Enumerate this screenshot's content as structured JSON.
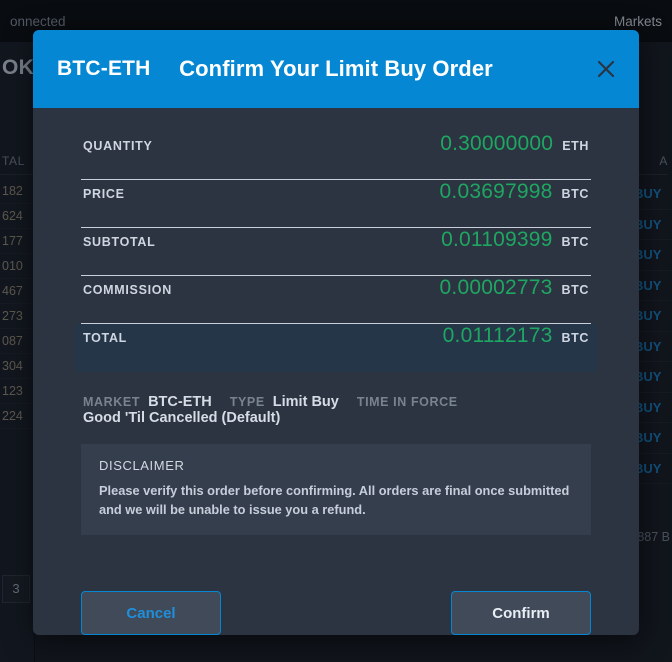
{
  "background": {
    "topbar": {
      "connection_status": "onnected",
      "nav_markets": "Markets"
    },
    "left_panel": {
      "title": "OK",
      "column_header": "TAL",
      "rows": [
        "182",
        "624",
        "177",
        "010",
        "467",
        "273",
        "087",
        "304",
        "123",
        "224"
      ],
      "page_chip": "3"
    },
    "right_panel": {
      "column_header": "A",
      "action_labels": [
        "BUY",
        "BUY",
        "BUY",
        "BUY",
        "BUY",
        "BUY",
        "BUY",
        "BUY",
        "BUY",
        "BUY"
      ],
      "footer_text": "7.887 B"
    }
  },
  "modal": {
    "market": "BTC-ETH",
    "title": "Confirm Your Limit Buy Order",
    "close_icon": "close-icon",
    "rows": [
      {
        "label": "QUANTITY",
        "value": "0.30000000",
        "unit": "ETH"
      },
      {
        "label": "PRICE",
        "value": "0.03697998",
        "unit": "BTC"
      },
      {
        "label": "SUBTOTAL",
        "value": "0.01109399",
        "unit": "BTC"
      },
      {
        "label": "COMMISSION",
        "value": "0.00002773",
        "unit": "BTC"
      },
      {
        "label": "TOTAL",
        "value": "0.01112173",
        "unit": "BTC"
      }
    ],
    "meta": [
      {
        "label": "MARKET",
        "value": "BTC-ETH"
      },
      {
        "label": "TYPE",
        "value": "Limit Buy"
      },
      {
        "label": "TIME IN FORCE",
        "value": "Good 'Til Cancelled (Default)"
      }
    ],
    "disclaimer": {
      "title": "DISCLAIMER",
      "text": "Please verify this order before confirming. All orders are final once submitted and we will be unable to issue you a refund."
    },
    "actions": {
      "cancel_label": "Cancel",
      "confirm_label": "Confirm"
    },
    "colors": {
      "header_blue": "#0587d4",
      "value_green": "#1ea662",
      "modal_bg": "#2c3441",
      "total_row_bg": "#253649",
      "disclaimer_bg": "#353e4c"
    }
  }
}
